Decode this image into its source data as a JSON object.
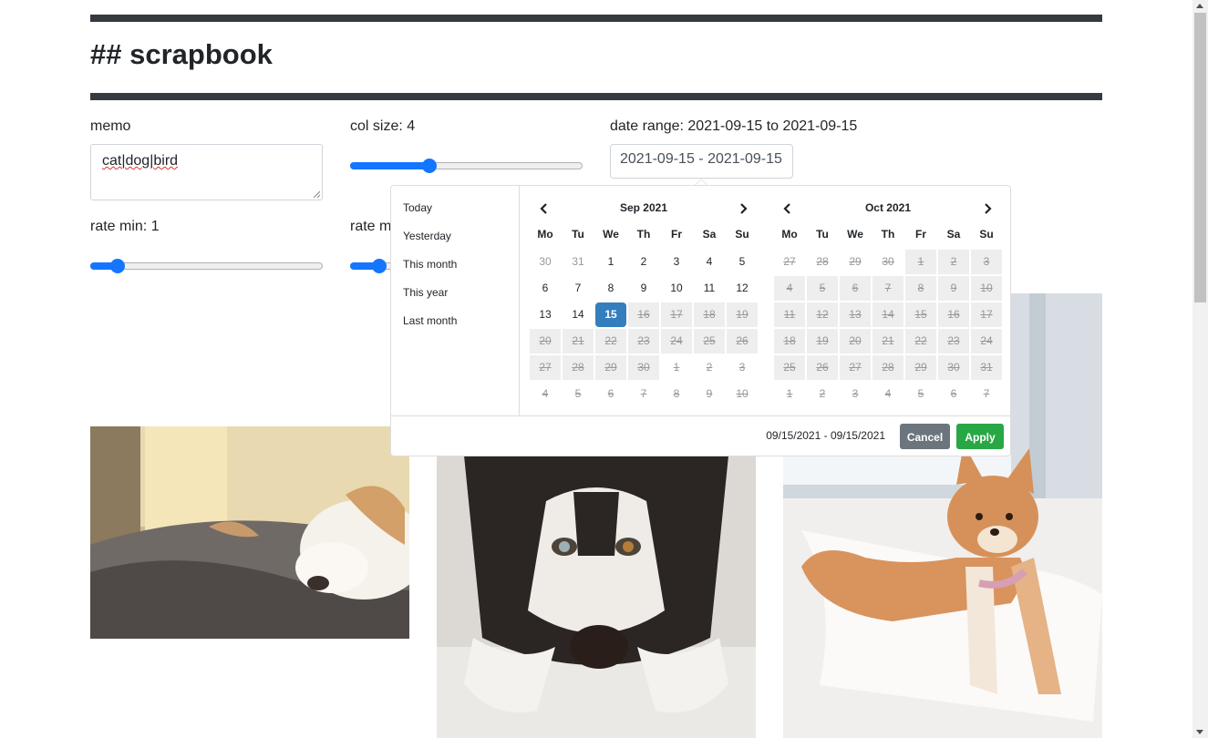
{
  "app": {
    "title": "## scrapbook"
  },
  "memo": {
    "label": "memo",
    "value_parts": [
      "cat",
      "|",
      "dog",
      "|",
      "bird"
    ]
  },
  "col_size": {
    "label": "col size: 4",
    "level": 0.33
  },
  "date_range": {
    "label": "date range: 2021-09-15 to 2021-09-15",
    "input_value": "2021-09-15 - 2021-09-15"
  },
  "rate_min": {
    "label": "rate min: 1",
    "level": 0.09
  },
  "rate_max": {
    "label": "rate m",
    "level": 0.1
  },
  "picker": {
    "ranges": [
      "Today",
      "Yesterday",
      "This month",
      "This year",
      "Last month"
    ],
    "weekdays": [
      "Mo",
      "Tu",
      "We",
      "Th",
      "Fr",
      "Sa",
      "Su"
    ],
    "left_calendar": {
      "month": "Sep 2021",
      "weeks": [
        [
          [
            "30",
            "off"
          ],
          [
            "31",
            "off"
          ],
          [
            "1",
            ""
          ],
          [
            "2",
            ""
          ],
          [
            "3",
            ""
          ],
          [
            "4",
            ""
          ],
          [
            "5",
            ""
          ]
        ],
        [
          [
            "6",
            ""
          ],
          [
            "7",
            ""
          ],
          [
            "8",
            ""
          ],
          [
            "9",
            ""
          ],
          [
            "10",
            ""
          ],
          [
            "11",
            ""
          ],
          [
            "12",
            ""
          ]
        ],
        [
          [
            "13",
            ""
          ],
          [
            "14",
            ""
          ],
          [
            "15",
            "active"
          ],
          [
            "16",
            "disabled"
          ],
          [
            "17",
            "disabled"
          ],
          [
            "18",
            "disabled"
          ],
          [
            "19",
            "disabled"
          ]
        ],
        [
          [
            "20",
            "disabled"
          ],
          [
            "21",
            "disabled"
          ],
          [
            "22",
            "disabled"
          ],
          [
            "23",
            "disabled"
          ],
          [
            "24",
            "disabled"
          ],
          [
            "25",
            "disabled"
          ],
          [
            "26",
            "disabled"
          ]
        ],
        [
          [
            "27",
            "disabled"
          ],
          [
            "28",
            "disabled"
          ],
          [
            "29",
            "disabled"
          ],
          [
            "30",
            "disabled"
          ],
          [
            "1",
            "disabled off"
          ],
          [
            "2",
            "disabled off"
          ],
          [
            "3",
            "disabled off"
          ]
        ],
        [
          [
            "4",
            "disabled off"
          ],
          [
            "5",
            "disabled off"
          ],
          [
            "6",
            "disabled off"
          ],
          [
            "7",
            "disabled off"
          ],
          [
            "8",
            "disabled off"
          ],
          [
            "9",
            "disabled off"
          ],
          [
            "10",
            "disabled off"
          ]
        ]
      ]
    },
    "right_calendar": {
      "month": "Oct 2021",
      "weeks": [
        [
          [
            "27",
            "disabled off"
          ],
          [
            "28",
            "disabled off"
          ],
          [
            "29",
            "disabled off"
          ],
          [
            "30",
            "disabled off"
          ],
          [
            "1",
            "disabled"
          ],
          [
            "2",
            "disabled"
          ],
          [
            "3",
            "disabled"
          ]
        ],
        [
          [
            "4",
            "disabled"
          ],
          [
            "5",
            "disabled"
          ],
          [
            "6",
            "disabled"
          ],
          [
            "7",
            "disabled"
          ],
          [
            "8",
            "disabled"
          ],
          [
            "9",
            "disabled"
          ],
          [
            "10",
            "disabled"
          ]
        ],
        [
          [
            "11",
            "disabled"
          ],
          [
            "12",
            "disabled"
          ],
          [
            "13",
            "disabled"
          ],
          [
            "14",
            "disabled"
          ],
          [
            "15",
            "disabled"
          ],
          [
            "16",
            "disabled"
          ],
          [
            "17",
            "disabled"
          ]
        ],
        [
          [
            "18",
            "disabled"
          ],
          [
            "19",
            "disabled"
          ],
          [
            "20",
            "disabled"
          ],
          [
            "21",
            "disabled"
          ],
          [
            "22",
            "disabled"
          ],
          [
            "23",
            "disabled"
          ],
          [
            "24",
            "disabled"
          ]
        ],
        [
          [
            "25",
            "disabled"
          ],
          [
            "26",
            "disabled"
          ],
          [
            "27",
            "disabled"
          ],
          [
            "28",
            "disabled"
          ],
          [
            "29",
            "disabled"
          ],
          [
            "30",
            "disabled"
          ],
          [
            "31",
            "disabled"
          ]
        ],
        [
          [
            "1",
            "disabled off"
          ],
          [
            "2",
            "disabled off"
          ],
          [
            "3",
            "disabled off"
          ],
          [
            "4",
            "disabled off"
          ],
          [
            "5",
            "disabled off"
          ],
          [
            "6",
            "disabled off"
          ],
          [
            "7",
            "disabled off"
          ]
        ]
      ]
    },
    "selected_text": "09/15/2021 - 09/15/2021",
    "cancel_label": "Cancel",
    "apply_label": "Apply"
  },
  "colors": {
    "accent": "#1476ff",
    "active_day": "#357ebd",
    "apply": "#28a745",
    "cancel": "#6c757d",
    "rule": "#343a40"
  },
  "images": [
    "sleeping-dog-photo",
    "husky-photo",
    "shiba-inu-photo"
  ]
}
